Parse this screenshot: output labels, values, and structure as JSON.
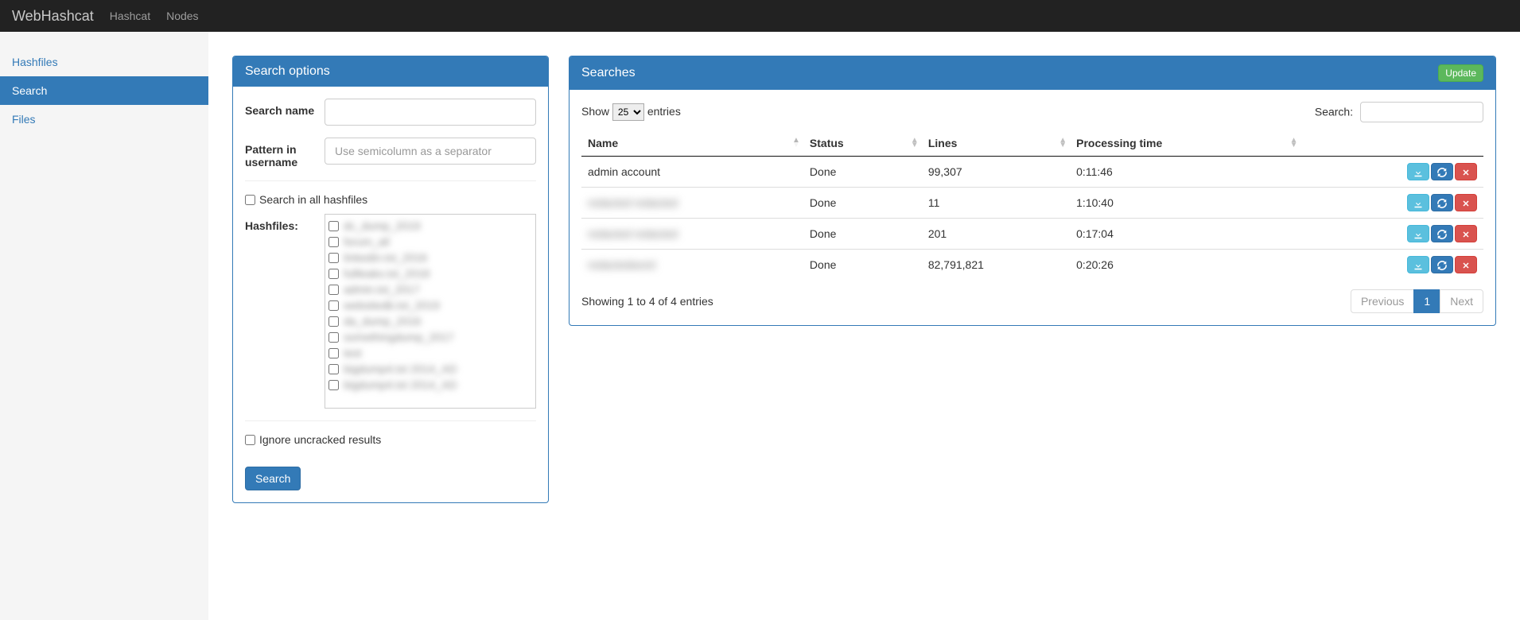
{
  "navbar": {
    "brand": "WebHashcat",
    "links": [
      "Hashcat",
      "Nodes"
    ]
  },
  "sidebar": {
    "items": [
      {
        "label": "Hashfiles",
        "active": false
      },
      {
        "label": "Search",
        "active": true
      },
      {
        "label": "Files",
        "active": false
      }
    ]
  },
  "search_options": {
    "title": "Search options",
    "name_label": "Search name",
    "pattern_label": "Pattern in username",
    "pattern_placeholder": "Use semicolumn as a separator",
    "all_hashfiles_label": "Search in all hashfiles",
    "hashfiles_label": "Hashfiles:",
    "hashfile_items": [
      "dc_dump_2019",
      "forum_all",
      "linkedin.txt_2016",
      "fullleaks.txt_2018",
      "admin.txt_2017",
      "websitedb.txt_2019",
      "da_dump_2016",
      "somethingdump_2017",
      "test",
      "bigdump4.txt 2014_AD",
      "bigdump4.txt 2014_AD"
    ],
    "ignore_label": "Ignore uncracked results",
    "submit_label": "Search"
  },
  "searches": {
    "title": "Searches",
    "update_label": "Update",
    "show_label_pre": "Show",
    "show_label_post": "entries",
    "page_size": "25",
    "filter_label": "Search:",
    "columns": [
      "Name",
      "Status",
      "Lines",
      "Processing time",
      ""
    ],
    "rows": [
      {
        "name": "admin account",
        "blurred": false,
        "status": "Done",
        "lines": "99,307",
        "time": "0:11:46"
      },
      {
        "name": "redacted redacted",
        "blurred": true,
        "status": "Done",
        "lines": "11",
        "time": "1:10:40"
      },
      {
        "name": "redacted redacted",
        "blurred": true,
        "status": "Done",
        "lines": "201",
        "time": "0:17:04"
      },
      {
        "name": "redactedword",
        "blurred": true,
        "status": "Done",
        "lines": "82,791,821",
        "time": "0:20:26"
      }
    ],
    "info": "Showing 1 to 4 of 4 entries",
    "prev_label": "Previous",
    "next_label": "Next",
    "page_current": "1"
  }
}
